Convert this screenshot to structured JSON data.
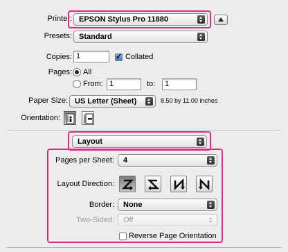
{
  "printer": {
    "label": "Printer:",
    "value": "EPSON Stylus Pro 11880"
  },
  "presets": {
    "label": "Presets:",
    "value": "Standard"
  },
  "copies": {
    "label": "Copies:",
    "value": "1",
    "collated_label": "Collated",
    "collated": true
  },
  "pages": {
    "label": "Pages:",
    "all_label": "All",
    "from_label": "From:",
    "from_value": "1",
    "to_label": "to:",
    "to_value": "1",
    "selected": "All"
  },
  "paper_size": {
    "label": "Paper Size:",
    "value": "US Letter (Sheet)",
    "dimensions": "8.50 by 11.00 inches"
  },
  "orientation": {
    "label": "Orientation:",
    "selected": "portrait"
  },
  "panel": {
    "value": "Layout"
  },
  "layout": {
    "pages_per_sheet_label": "Pages per Sheet:",
    "pages_per_sheet_value": "4",
    "direction_label": "Layout Direction:",
    "direction_selected": 0,
    "border_label": "Border:",
    "border_value": "None",
    "two_sided_label": "Two-Sided:",
    "two_sided_value": "Off",
    "reverse_label": "Reverse Page Orientation",
    "reverse_checked": false
  },
  "colors": {
    "highlight": "#e0278a",
    "background": "#ececec"
  }
}
